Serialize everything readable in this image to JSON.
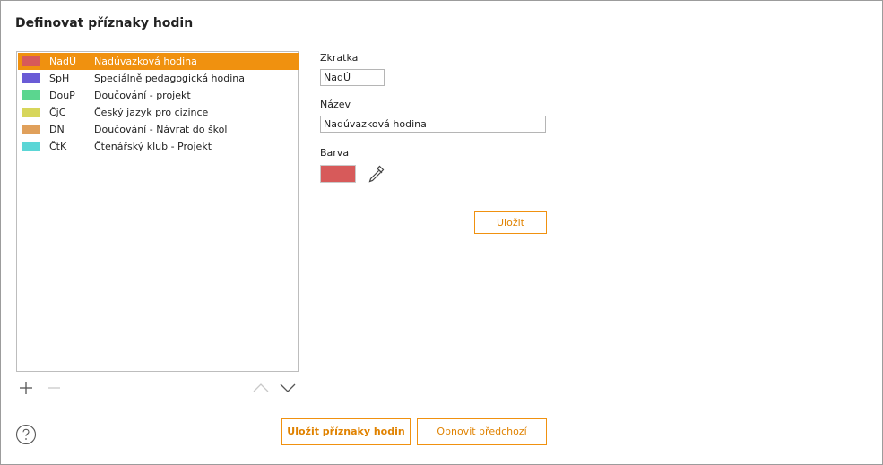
{
  "dialog": {
    "title": "Definovat příznaky hodin"
  },
  "list": {
    "items": [
      {
        "abbr": "NadÚ",
        "name": "Nadúvazková hodina",
        "color": "#d75a5a",
        "selected": true
      },
      {
        "abbr": "SpH",
        "name": "Speciálně pedagogická hodina",
        "color": "#6a5bd6",
        "selected": false
      },
      {
        "abbr": "DouP",
        "name": "Doučování - projekt",
        "color": "#5bd68f",
        "selected": false
      },
      {
        "abbr": "ČjC",
        "name": "Český jazyk pro cizince",
        "color": "#d7d65b",
        "selected": false
      },
      {
        "abbr": "DN",
        "name": "Doučování - Návrat do škol",
        "color": "#e0a05b",
        "selected": false
      },
      {
        "abbr": "ČtK",
        "name": "Čtenářský klub - Projekt",
        "color": "#5bd6d6",
        "selected": false
      }
    ],
    "tools": {
      "add": "plus-icon",
      "remove": "minus-icon",
      "move_up": "chevron-up-icon",
      "move_down": "chevron-down-icon"
    }
  },
  "form": {
    "abbr_label": "Zkratka",
    "abbr_value": "NadÚ",
    "name_label": "Název",
    "name_value": "Nadúvazková hodina",
    "color_label": "Barva",
    "color_value": "#d75a5a",
    "picker_icon": "eyedropper-icon",
    "save_label": "Uložit"
  },
  "footer": {
    "help_icon": "help-icon",
    "save_flags_label": "Uložit příznaky hodin",
    "restore_label": "Obnovit předchozí"
  },
  "colors": {
    "accent": "#f0910f",
    "accent_text": "#e08200"
  }
}
